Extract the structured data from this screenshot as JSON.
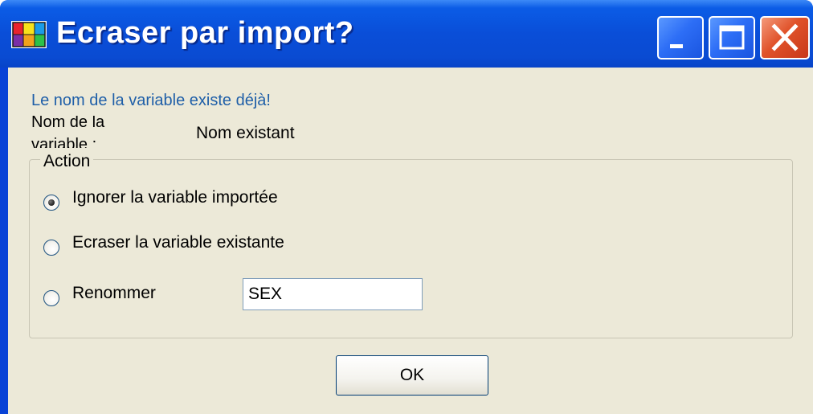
{
  "window": {
    "title": "Ecraser par import?",
    "controls": {
      "minimize_icon": "minimize-icon",
      "maximize_icon": "maximize-icon",
      "close_icon": "close-icon"
    }
  },
  "dialog": {
    "message": "Le nom de la variable existe déjà!",
    "variable_name_label": "Nom de la variable :",
    "existing_name": "Nom existant"
  },
  "action": {
    "legend": "Action",
    "options": [
      {
        "label": "Ignorer la variable importée",
        "checked": true
      },
      {
        "label": "Ecraser la variable existante",
        "checked": false
      },
      {
        "label": "Renommer",
        "checked": false
      }
    ],
    "rename_value": "SEX"
  },
  "buttons": {
    "ok_label": "OK"
  },
  "colors": {
    "titlebar": "#0a4ed8",
    "client_background": "#ece9d8",
    "message_text": "#1f5fa8",
    "close_button": "#e0522a"
  }
}
